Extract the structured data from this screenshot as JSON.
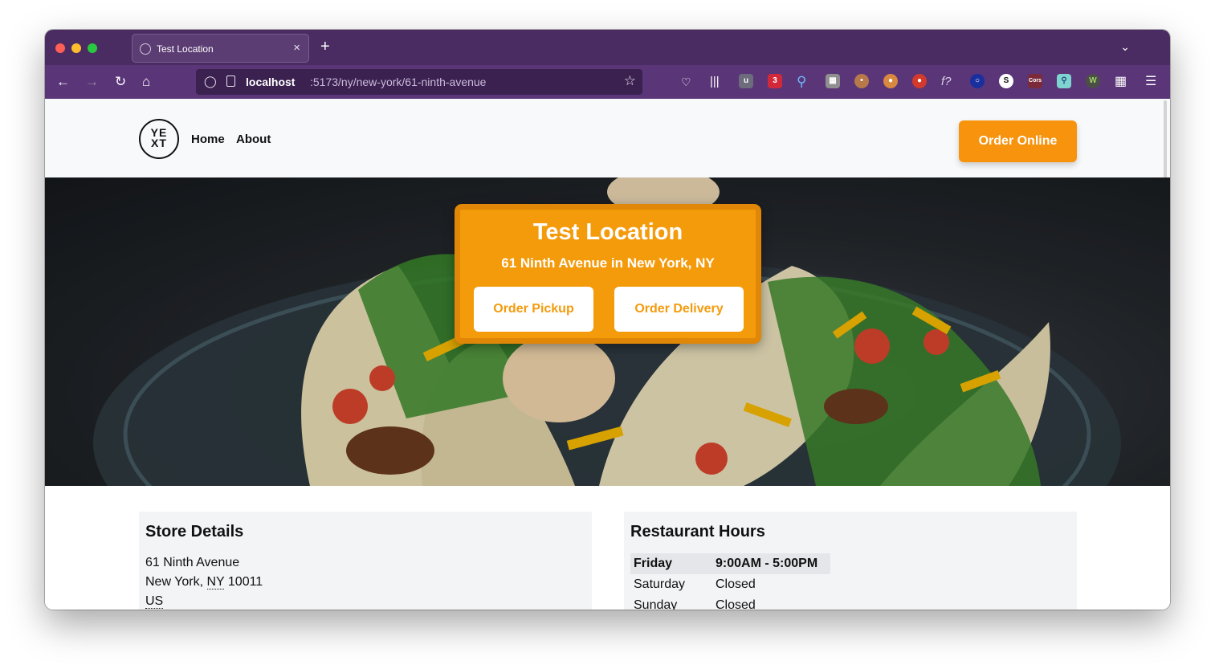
{
  "browser": {
    "tab_title": "Test Location",
    "tab_close": "×",
    "new_tab": "+",
    "url_host": "localhost",
    "url_path": ":5173/ny/new-york/61-ninth-avenue",
    "extension_badge": "3"
  },
  "header": {
    "logo_text_top": "YE",
    "logo_text_bottom": "XT",
    "nav": [
      "Home",
      "About"
    ],
    "cta": "Order Online"
  },
  "hero": {
    "title": "Test Location",
    "subtitle": "61 Ninth Avenue in New York, NY",
    "buttons": [
      "Order Pickup",
      "Order Delivery"
    ]
  },
  "store_details": {
    "title": "Store Details",
    "line1": "61 Ninth Avenue",
    "city": "New York,",
    "state": "NY",
    "zip": "10011",
    "country": "US"
  },
  "hours": {
    "title": "Restaurant Hours",
    "rows": [
      {
        "day": "Friday",
        "time": "9:00AM - 5:00PM",
        "today": true
      },
      {
        "day": "Saturday",
        "time": "Closed"
      },
      {
        "day": "Sunday",
        "time": "Closed"
      }
    ]
  },
  "colors": {
    "accent": "#f49b0c",
    "browser_chrome": "#4a2c62"
  }
}
